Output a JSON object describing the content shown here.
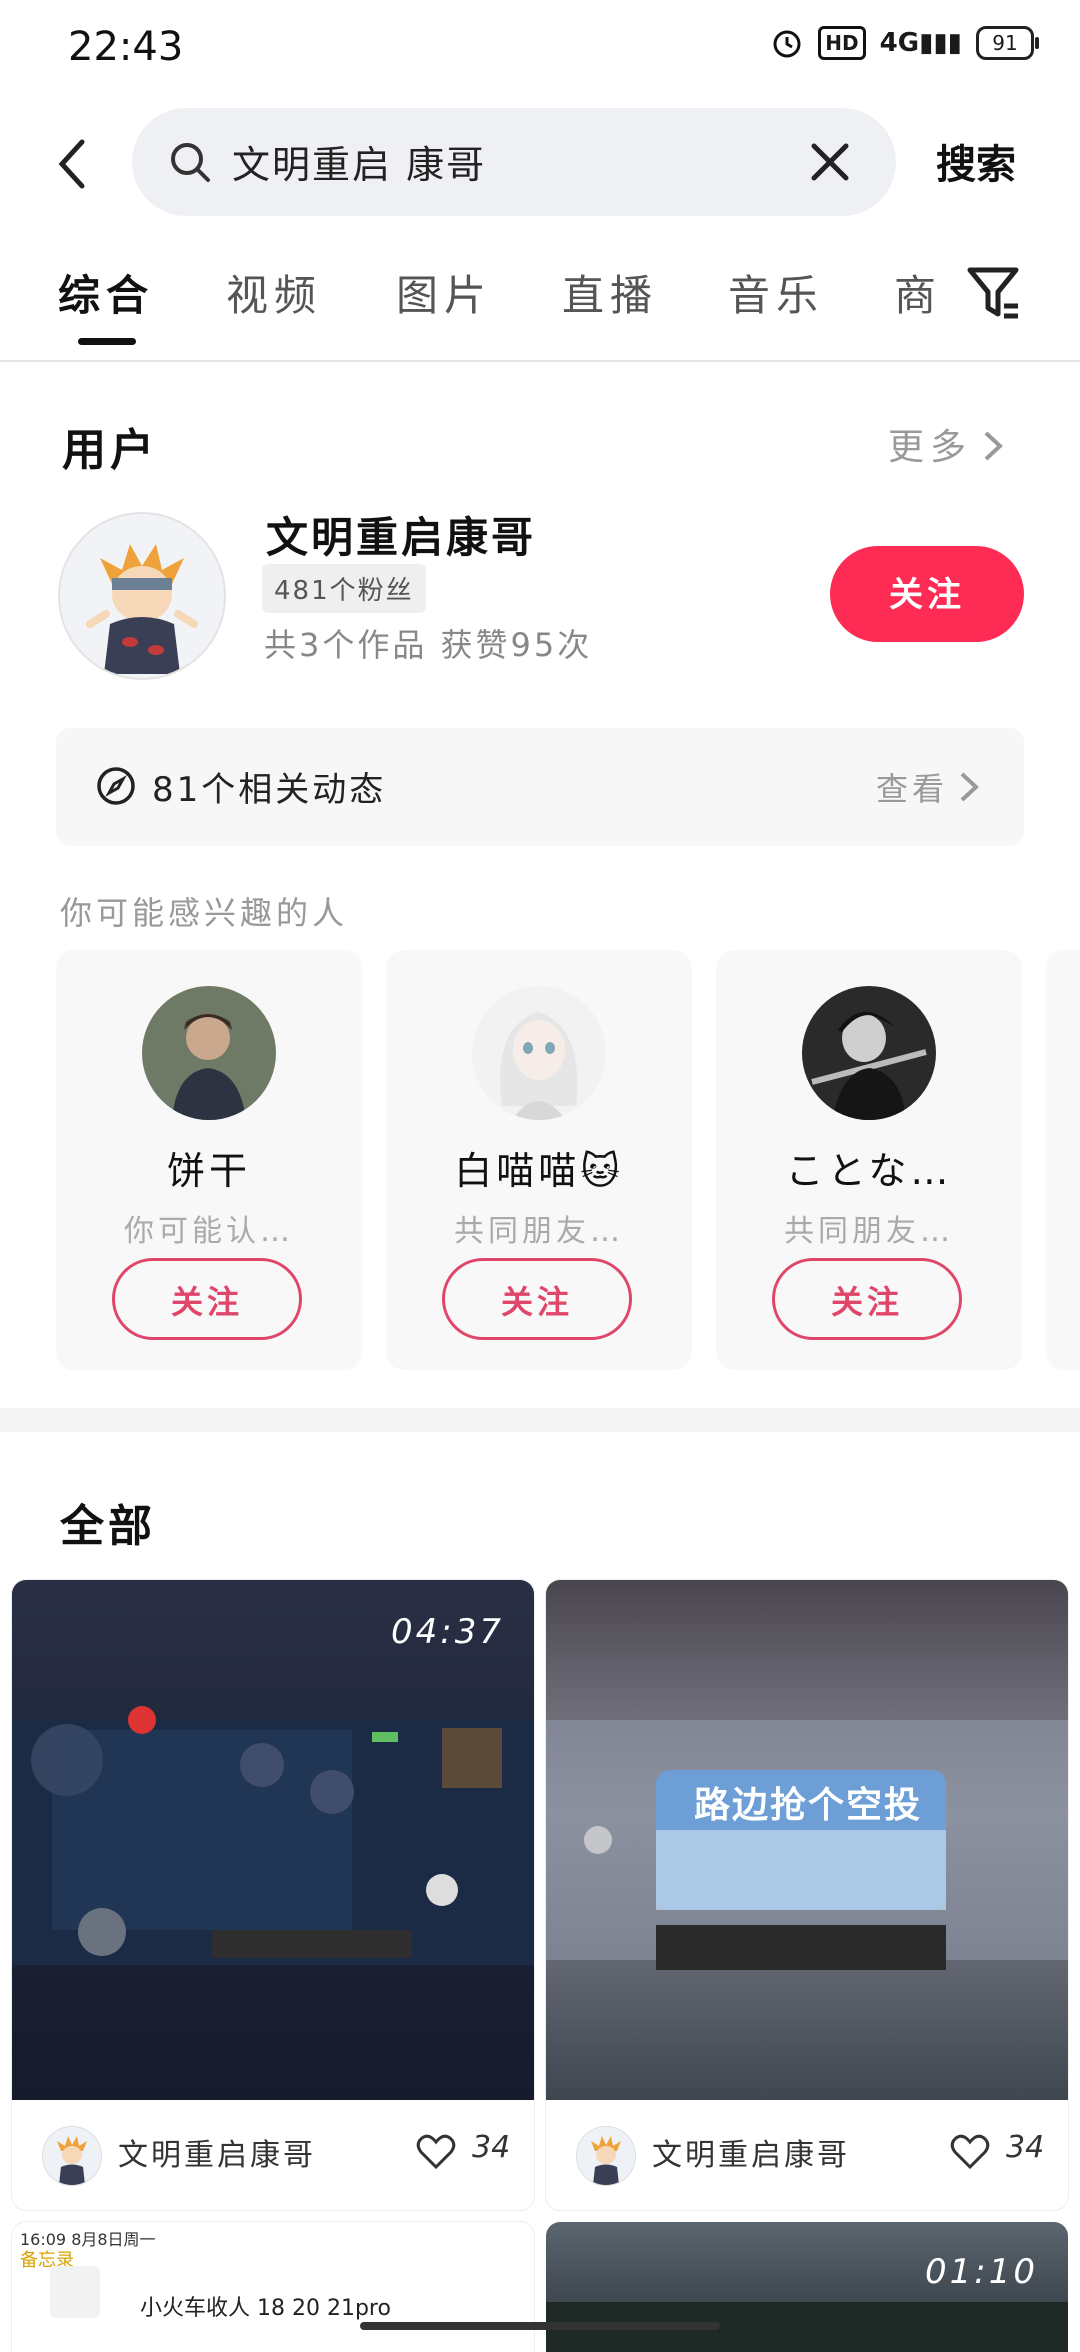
{
  "status": {
    "time": "22:43",
    "network": "4G",
    "hd": "HD",
    "battery": "91"
  },
  "search": {
    "query": "文明重启 康哥",
    "button": "搜索"
  },
  "tabs": [
    "综合",
    "视频",
    "图片",
    "直播",
    "音乐",
    "商"
  ],
  "users": {
    "title": "用户",
    "more": "更多",
    "name": "文明重启康哥",
    "fans": "481个粉丝",
    "stats": "共3个作品 获赞95次",
    "follow": "关注",
    "dynamics": "81个相关动态",
    "view": "查看"
  },
  "may_know": {
    "title": "你可能感兴趣的人",
    "cards": [
      {
        "name": "饼干",
        "sub": "你可能认…",
        "follow": "关注"
      },
      {
        "name": "白喵喵🐱",
        "sub": "共同朋友…",
        "follow": "关注"
      },
      {
        "name": "ことな…",
        "sub": "共同朋友…",
        "follow": "关注"
      }
    ]
  },
  "all": {
    "title": "全部",
    "videos": [
      {
        "duration": "04:37",
        "author": "文明重启康哥",
        "likes": "34",
        "overlay": ""
      },
      {
        "duration": "",
        "author": "文明重启康哥",
        "likes": "34",
        "overlay": "路边抢个空投"
      }
    ],
    "next": {
      "left_text": "小火车收人 18 20 21pro",
      "left_top": "16:09 8月8日周一",
      "left_back": "备忘录",
      "right_duration": "01:10"
    }
  },
  "colors": {
    "accent": "#fe2c55",
    "outline": "#e0466a"
  }
}
